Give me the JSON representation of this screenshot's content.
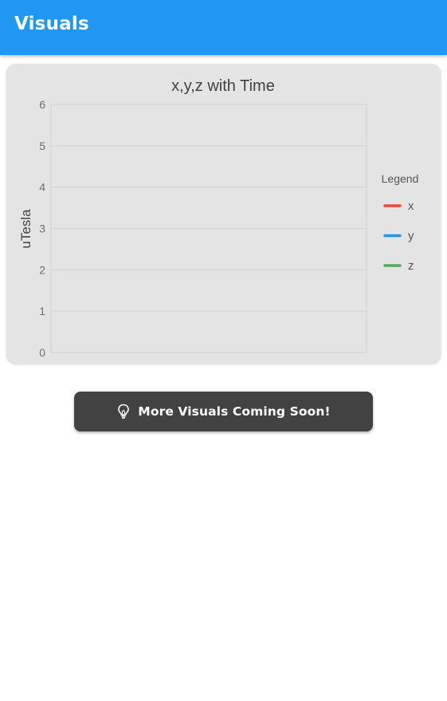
{
  "app_bar": {
    "title": "Visuals",
    "background": "#2196f3"
  },
  "chart": {
    "chart_data": {
      "type": "line",
      "title": "x,y,z with Time",
      "xlabel": "",
      "ylabel": "uTesla",
      "ylim": [
        0,
        6
      ],
      "yticks": [
        "0",
        "1",
        "2",
        "3",
        "4",
        "5",
        "6"
      ],
      "grid": true,
      "legend_title": "Legend",
      "legend_position": "right",
      "series": [
        {
          "name": "x",
          "color": "#f44336",
          "values": []
        },
        {
          "name": "y",
          "color": "#2196f3",
          "values": []
        },
        {
          "name": "z",
          "color": "#4caf50",
          "values": []
        }
      ]
    }
  },
  "cta": {
    "label": "More Visuals Coming Soon!",
    "icon": "lightbulb-icon"
  }
}
